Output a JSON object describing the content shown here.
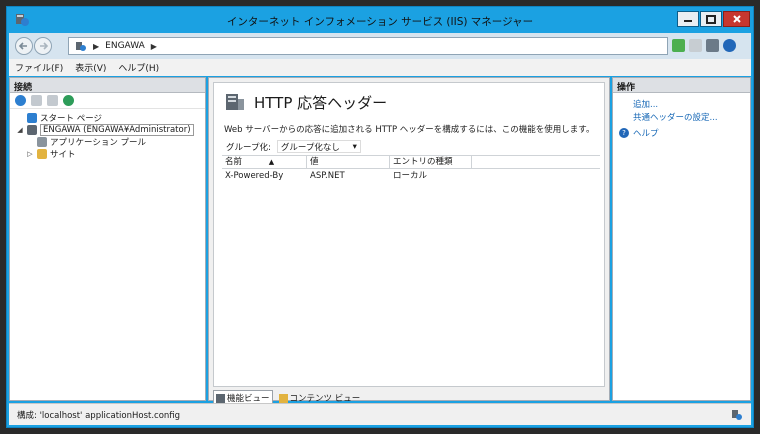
{
  "window": {
    "title": "インターネット インフォメーション サービス (IIS) マネージャー"
  },
  "address": {
    "path": [
      "ENGAWA"
    ]
  },
  "menu": {
    "file": "ファイル(F)",
    "view": "表示(V)",
    "help": "ヘルプ(H)"
  },
  "connections": {
    "header": "接続",
    "tree": {
      "start_page": "スタート ページ",
      "server": "ENGAWA (ENGAWA¥Administrator)",
      "app_pools": "アプリケーション プール",
      "sites": "サイト"
    }
  },
  "feature": {
    "title": "HTTP 応答ヘッダー",
    "description": "Web サーバーからの応答に追加される HTTP ヘッダーを構成するには、この機能を使用します。",
    "group_by_label": "グループ化:",
    "group_by_value": "グループ化なし",
    "columns": [
      "名前",
      "値",
      "エントリの種類"
    ],
    "rows": [
      [
        "X-Powered-By",
        "ASP.NET",
        "ローカル"
      ]
    ]
  },
  "views": {
    "features": "機能ビュー",
    "content": "コンテンツ ビュー"
  },
  "actions": {
    "header": "操作",
    "add": "追加...",
    "common_headers": "共通ヘッダーの設定...",
    "help": "ヘルプ"
  },
  "status": {
    "text": "構成: 'localhost' applicationHost.config"
  },
  "colors": {
    "window_border": "#1ba1e2",
    "link": "#1466b5",
    "close_button": "#c7372f"
  }
}
